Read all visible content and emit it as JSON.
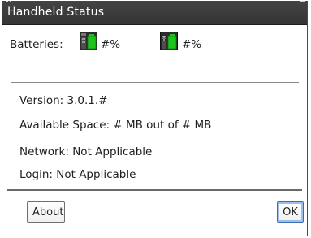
{
  "dialog": {
    "title": "Handheld Status"
  },
  "batteries": {
    "label": "Batteries:",
    "battery1_icon": "battery-icon",
    "battery1_value": "#%",
    "battery2_icon": "wireless-battery-icon",
    "battery2_value": "#%"
  },
  "info": {
    "version": "Version: 3.0.1.#",
    "space": "Available Space: # MB out of # MB",
    "network": "Network: Not Applicable",
    "login": "Login: Not Applicable"
  },
  "buttons": {
    "about": "About",
    "ok": "OK"
  },
  "colors": {
    "battery_green": "#1cc51c",
    "titlebar": "#3a3a3a",
    "ok_focus": "#3b6fb4"
  }
}
